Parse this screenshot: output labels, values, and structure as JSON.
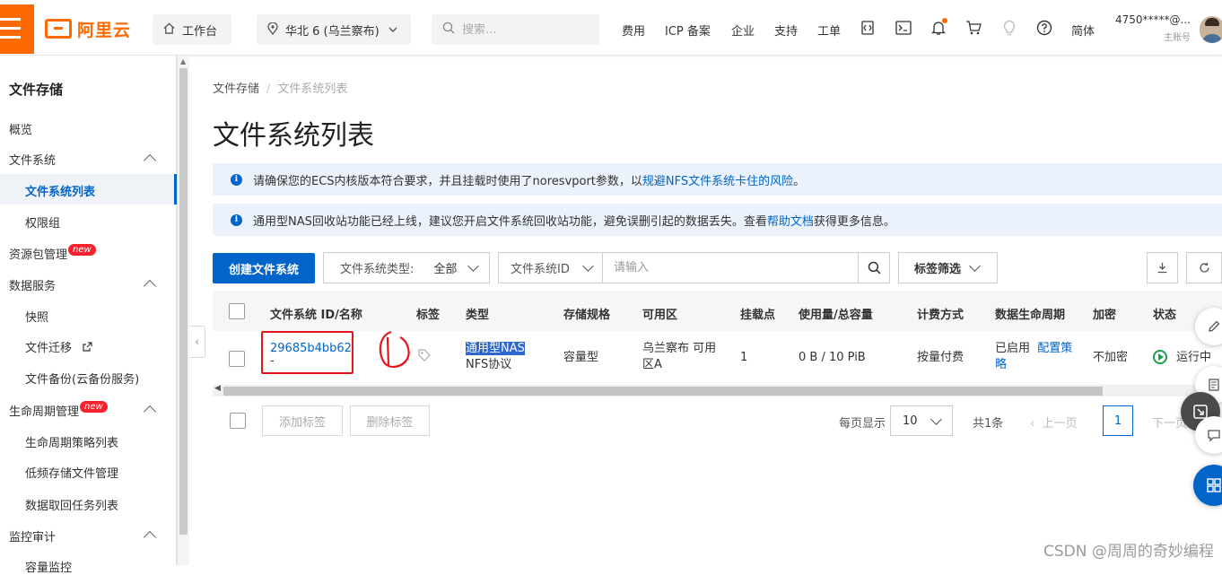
{
  "topbar": {
    "logo_text": "阿里云",
    "workbench": "工作台",
    "region": "华北 6 (乌兰察布)",
    "search_placeholder": "搜索...",
    "nav": [
      "费用",
      "ICP 备案",
      "企业",
      "支持",
      "工单"
    ],
    "lang": "简体",
    "account_name": "4750*****@...",
    "account_role": "主账号",
    "icons": [
      "menu-icon",
      "home-icon",
      "location-pin-icon",
      "search-icon",
      "code-icon",
      "terminal-icon",
      "bell-icon",
      "cart-icon",
      "lightbulb-icon",
      "help-icon"
    ],
    "brand_color": "#ff6a00"
  },
  "sidebar": {
    "title": "文件存储",
    "items": {
      "overview": "概览",
      "file_system": "文件系统",
      "fs_list": "文件系统列表",
      "permission_group": "权限组",
      "resource_pack": "资源包管理",
      "data_service": "数据服务",
      "snapshot": "快照",
      "file_migration": "文件迁移",
      "file_backup": "文件备份(云备份服务)",
      "lifecycle": "生命周期管理",
      "lifecycle_policy": "生命周期策略列表",
      "low_freq": "低频存储文件管理",
      "data_retrieval": "数据取回任务列表",
      "monitor_audit": "监控审计",
      "capacity_monitor": "容量监控"
    },
    "new_badge": "new",
    "active_color": "#0064c8"
  },
  "main": {
    "breadcrumb": [
      "文件存储",
      "文件系统列表"
    ],
    "page_title": "文件系统列表",
    "notice1": {
      "text": "请确保您的ECS内核版本符合要求，并且挂载时使用了noresvport参数，以",
      "link": "规避NFS文件系统卡住的风险",
      "tail": "。"
    },
    "notice2": {
      "text": "通用型NAS回收站功能已经上线，建议您开启文件系统回收站功能，避免误删引起的数据丢失。查看",
      "link": "帮助文档",
      "tail": "获得更多信息。"
    },
    "toolbar": {
      "create": "创建文件系统",
      "type_label": "文件系统类型:",
      "type_value": "全部",
      "field": "文件系统ID",
      "input_placeholder": "请输入",
      "tag_filter": "标签筛选"
    },
    "table": {
      "columns": [
        "文件系统 ID/名称",
        "标签",
        "类型",
        "存储规格",
        "可用区",
        "挂载点",
        "使用量/总容量",
        "计费方式",
        "数据生命周期",
        "加密",
        "状态"
      ],
      "rows": [
        {
          "id": "29685b4bb62",
          "name": "-",
          "type": "通用型NAS",
          "protocol": "NFS协议",
          "spec": "容量型",
          "zone_line1": "乌兰察布 可用",
          "zone_line2": "区A",
          "mounts": "1",
          "usage": "0 B / 10 PiB",
          "billing": "按量付费",
          "lifecycle_status": "已启用",
          "lifecycle_link1": "配置策",
          "lifecycle_link2": "略",
          "encryption": "不加密",
          "status": "运行中"
        }
      ]
    },
    "footer": {
      "add_tag": "添加标签",
      "remove_tag": "删除标签",
      "per_page_label": "每页显示",
      "per_page": "10",
      "total": "共1条",
      "prev": "上一页",
      "page": "1",
      "next": "下一页"
    },
    "annotation_mark": "1"
  },
  "watermark": "CSDN @周周的奇妙编程"
}
